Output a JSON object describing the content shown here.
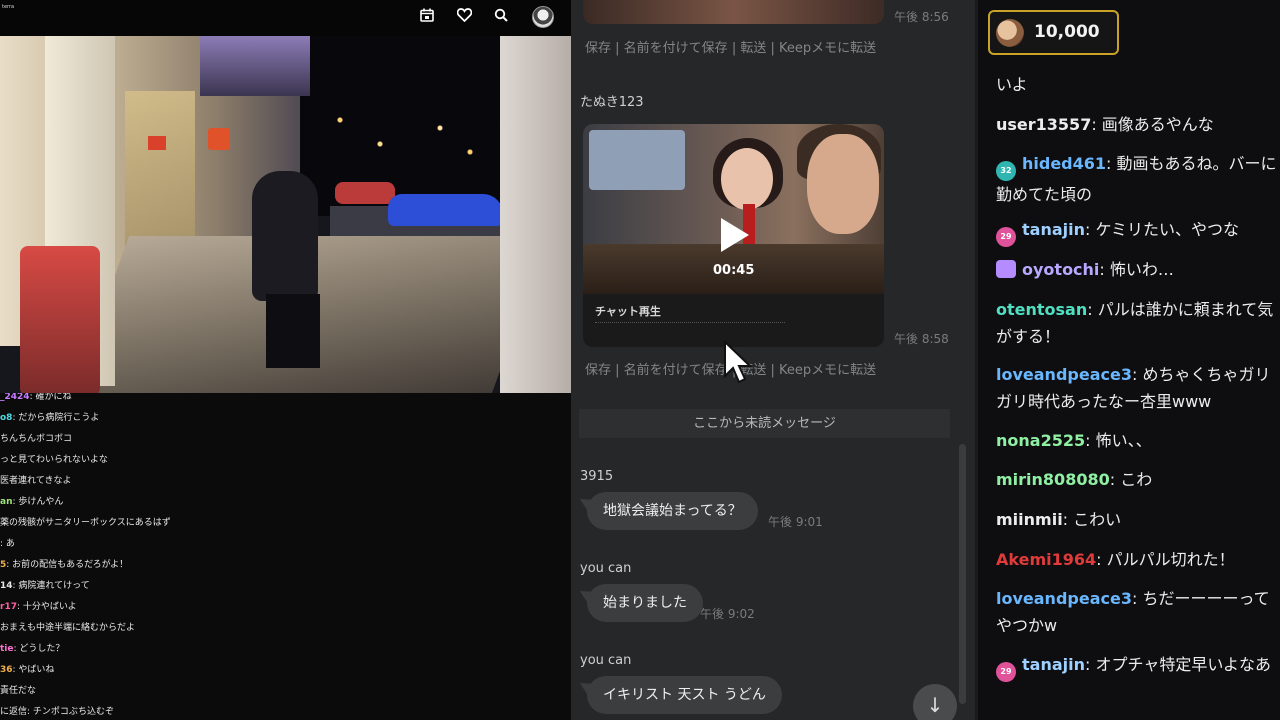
{
  "app": {
    "logo_text": "terra",
    "top_icons": [
      "calendar-icon",
      "heart-icon",
      "search-icon"
    ]
  },
  "left_chat": {
    "rows": [
      {
        "name": "_2424",
        "color": "#c77dff",
        "text": ": 確かにね"
      },
      {
        "name": "o8",
        "color": "#4ddbe0",
        "text": ": だから病院行こうよ"
      },
      {
        "name": "",
        "color": "#e8e8e8",
        "text": "ちんちんボコボコ"
      },
      {
        "name": "",
        "color": "#e8e8e8",
        "text": "っと見てわいられないよな"
      },
      {
        "name": "",
        "color": "#e8e8e8",
        "text": "医者連れてきなよ"
      },
      {
        "name": "an",
        "color": "#9ee37d",
        "text": ": 歩けんやん"
      },
      {
        "name": "",
        "color": "#e8e8e8",
        "text": "薬の残骸がサニタリーボックスにあるはず"
      },
      {
        "name": "",
        "color": "#e8e8e8",
        "text": ": あ"
      },
      {
        "name": "5",
        "color": "#f0b04c",
        "text": ": お前の配信もあるだろがよ！"
      },
      {
        "name": "14",
        "color": "#e8e8e8",
        "text": ": 病院連れてけって"
      },
      {
        "name": "r17",
        "color": "#ff5fa2",
        "text": ": 十分やばいよ"
      },
      {
        "name": "",
        "color": "#e8e8e8",
        "text": "おまえも中途半端に絡むからだよ"
      },
      {
        "name": "tie",
        "color": "#ff6fcf",
        "text": ": どうした？"
      },
      {
        "name": "36",
        "color": "#f0b04c",
        "text": ": やばいね"
      },
      {
        "name": "",
        "color": "#e8e8e8",
        "text": "責任だな"
      },
      {
        "name": "",
        "color": "#e8e8e8",
        "text": "に返信: チンポコぶち込むぞ"
      }
    ]
  },
  "messages": {
    "top_time": "午後 8:56",
    "actions": [
      "保存",
      "名前を付けて保存",
      "転送",
      "Keepメモに転送"
    ],
    "sender1": "たぬき123",
    "video": {
      "duration": "00:45",
      "replay_label": "チャット再生",
      "time": "午後 8:58"
    },
    "unread_label": "ここから未読メッセージ",
    "msgs": [
      {
        "sender": "3915",
        "text": "地獄会議始まってる？",
        "time": "午後 9:01"
      },
      {
        "sender": "you can",
        "text": "始まりました",
        "time": "午後 9:02"
      },
      {
        "sender": "you can",
        "text": "イキリスト 天スト うどん",
        "time": ""
      }
    ]
  },
  "right_chat": {
    "points": "10,000",
    "rows": [
      {
        "user": "",
        "color": "#ececec",
        "text": "いよ",
        "badge": ""
      },
      {
        "user": "user13557",
        "color": "#ececec",
        "text": ": 画像あるやんな",
        "badge": ""
      },
      {
        "user": "hided461",
        "color": "#6ab7ff",
        "text": ": 動画もあるね。バーに勤めてた頃の",
        "badge": "32"
      },
      {
        "user": "tanajin",
        "color": "#9fd0ff",
        "text": ": ケミリたい、やつな",
        "badge": "29"
      },
      {
        "user": "oyotochi",
        "color": "#b8a8ff",
        "text": ": 怖いわ…",
        "badge": "gift"
      },
      {
        "user": "otentosan",
        "color": "#4fe0c2",
        "text": ": パルは誰かに頼まれて気がする！",
        "badge": ""
      },
      {
        "user": "loveandpeace3",
        "color": "#6ab7ff",
        "text": ": めちゃくちゃガリガリ時代あったなー杏里www",
        "badge": ""
      },
      {
        "user": "nona2525",
        "color": "#8ff0a4",
        "text": ": 怖い、、",
        "badge": ""
      },
      {
        "user": "mirin808080",
        "color": "#8ff0a4",
        "text": ": こわ",
        "badge": ""
      },
      {
        "user": "miinmii",
        "color": "#ececec",
        "text": ": こわい",
        "badge": ""
      },
      {
        "user": "Akemi1964",
        "color": "#e03a3a",
        "text": ": パルパル切れた！",
        "badge": ""
      },
      {
        "user": "loveandpeace3",
        "color": "#6ab7ff",
        "text": ": ちだーーーーってやつかw",
        "badge": ""
      },
      {
        "user": "tanajin",
        "color": "#9fd0ff",
        "text": ": オプチャ特定早いよなあ",
        "badge": "29"
      }
    ]
  }
}
